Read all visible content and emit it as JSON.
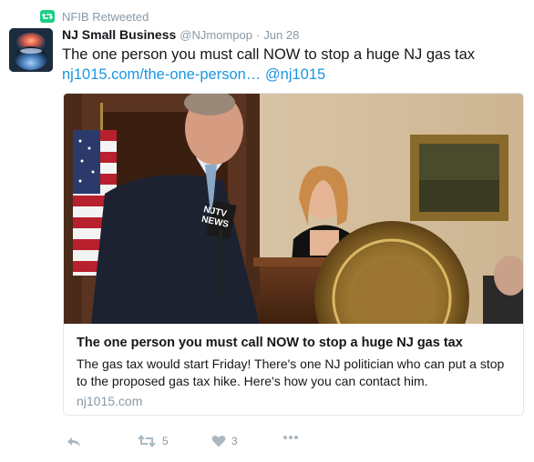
{
  "retweet_context": {
    "icon": "retweet-icon",
    "icon_color": "#19cf86",
    "label": "NFIB Retweeted"
  },
  "tweet": {
    "display_name": "NJ Small Business",
    "screen_name": "@NJmompop",
    "separator": "·",
    "timestamp": "Jun 28",
    "text": "The one person you must call NOW to stop a huge NJ gas tax",
    "link_text": "nj1015.com/the-one-person…",
    "mention": "@nj1015"
  },
  "card": {
    "title": "The one person you must call NOW to stop a huge NJ gas tax",
    "description": "The gas tax would start Friday! There's one NJ politician who can put a stop to the proposed gas tax hike. Here's how you can contact him.",
    "domain": "nj1015.com",
    "image_podium_text": "NJTV NEWS"
  },
  "actions": {
    "reply_icon": "reply-icon",
    "retweet_icon": "retweet-icon",
    "retweet_count": "5",
    "like_icon": "heart-icon",
    "like_count": "3",
    "more_icon": "more-icon"
  },
  "colors": {
    "link": "#1b95e0",
    "muted": "#8899a6",
    "text": "#14171a",
    "border": "#e1e8ed"
  }
}
